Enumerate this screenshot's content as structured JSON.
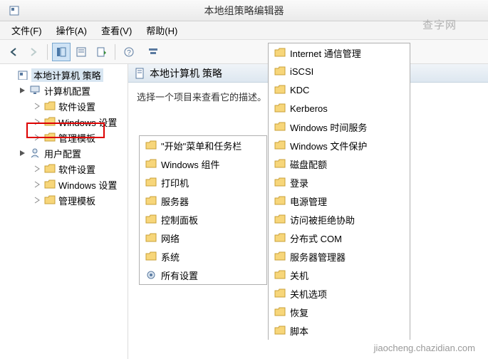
{
  "window": {
    "title": "本地组策略编辑器"
  },
  "menubar": {
    "file": "文件(F)",
    "action": "操作(A)",
    "view": "查看(V)",
    "help": "帮助(H)"
  },
  "tree": {
    "root": "本地计算机 策略",
    "computer_cfg": "计算机配置",
    "software1": "软件设置",
    "windows1": "Windows 设置",
    "admin1": "管理模板",
    "user_cfg": "用户配置",
    "software2": "软件设置",
    "windows2": "Windows 设置",
    "admin2": "管理模板"
  },
  "content": {
    "heading": "本地计算机 策略",
    "hint": "选择一个项目来查看它的描述。"
  },
  "list1": [
    "\"开始\"菜单和任务栏",
    "Windows 组件",
    "打印机",
    "服务器",
    "控制面板",
    "网络",
    "系统",
    "所有设置"
  ],
  "list2": [
    "Internet 通信管理",
    "iSCSI",
    "KDC",
    "Kerberos",
    "Windows 时间服务",
    "Windows 文件保护",
    "磁盘配额",
    "登录",
    "电源管理",
    "访问被拒绝协助",
    "分布式 COM",
    "服务器管理器",
    "关机",
    "关机选项",
    "恢复",
    "脚本"
  ],
  "watermark": "jiaocheng.chazidian.com",
  "watermark2": "查字网"
}
